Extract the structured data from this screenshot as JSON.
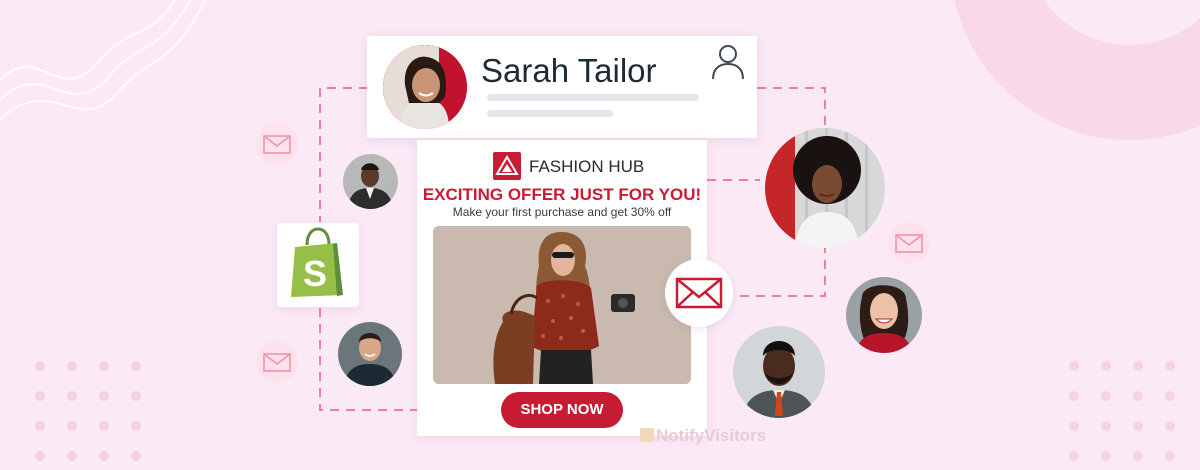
{
  "profile": {
    "name": "Sarah Tailor"
  },
  "email": {
    "brand_name": "FASHION HUB",
    "offer_title": "EXCITING OFFER JUST FOR YOU!",
    "offer_subtitle": "Make your first purchase and get 30% off",
    "cta_label": "SHOP NOW"
  },
  "watermark": {
    "text": "NotifyVisitors"
  },
  "colors": {
    "background": "#fbe9f6",
    "accent": "#c81b34",
    "dashed_line": "#f27e95",
    "shopify_green": "#95bf47"
  }
}
